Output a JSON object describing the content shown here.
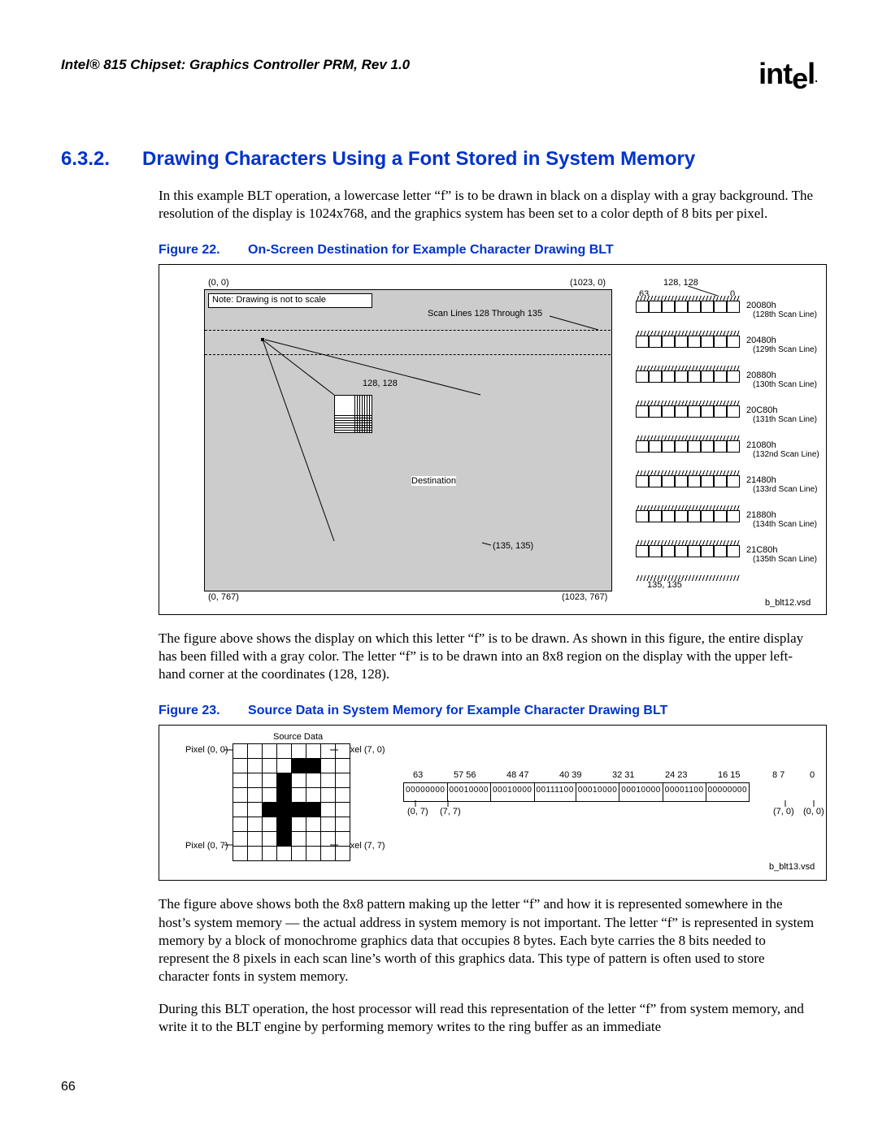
{
  "header": {
    "doc_title": "Intel® 815 Chipset: Graphics Controller PRM, Rev 1.0",
    "logo_text": "intel"
  },
  "section": {
    "number": "6.3.2.",
    "title": "Drawing Characters Using a Font Stored in System Memory"
  },
  "para1": "In this example BLT operation, a lowercase letter “f” is to be drawn in black on a display with a gray background. The resolution of the display is 1024x768, and the graphics system has been set to a color depth of 8 bits per pixel.",
  "fig22": {
    "caption_no": "Figure 22.",
    "caption_text": "On-Screen Destination for Example Character Drawing BLT",
    "labels": {
      "tl": "(0, 0)",
      "tr": "(1023, 0)",
      "bl": "(0, 767)",
      "br": "(1023, 767)",
      "note": "Note: Drawing is not to scale",
      "scan": "Scan Lines 128 Through 135",
      "c128": "128, 128",
      "dest": "Destination",
      "c135": "(135, 135)",
      "top63": "63",
      "top0": "0",
      "top128": "128, 128",
      "bot135": "135, 135",
      "row0a": "20080h",
      "row0b": "(128th Scan Line)",
      "row1a": "20480h",
      "row1b": "(129th Scan Line)",
      "row2a": "20880h",
      "row2b": "(130th Scan Line)",
      "row3a": "20C80h",
      "row3b": "(131th Scan Line)",
      "row4a": "21080h",
      "row4b": "(132nd Scan Line)",
      "row5a": "21480h",
      "row5b": "(133rd Scan Line)",
      "row6a": "21880h",
      "row6b": "(134th Scan Line)",
      "row7a": "21C80h",
      "row7b": "(135th Scan Line)",
      "vsd": "b_blt12.vsd"
    }
  },
  "para2": "The figure above shows the display on which this letter “f” is to be drawn. As shown in this figure, the entire display has been filled with a gray color. The letter “f” is to be drawn into an 8x8 region on the display with the upper left-hand corner at the coordinates (128, 128).",
  "fig23": {
    "caption_no": "Figure 23.",
    "caption_text": "Source Data in System Memory for Example Character Drawing BLT",
    "labels": {
      "srcdata": "Source Data",
      "p00": "Pixel (0, 0)",
      "p70": "Pixel (7, 0)",
      "p07": "Pixel (0, 7)",
      "p77": "Pixel (7, 7)",
      "b63": "63",
      "b57": "57 56",
      "b48": "48 47",
      "b40": "40 39",
      "b32": "32 31",
      "b24": "24 23",
      "b16": "16 15",
      "b8": "8 7",
      "b0": "0",
      "byte0": "00000000",
      "byte1": "00010000",
      "byte2": "00010000",
      "byte3": "00111100",
      "byte4": "00010000",
      "byte5": "00010000",
      "byte6": "00001100",
      "byte7": "00000000",
      "under07": "(0, 7)",
      "under77": "(7, 7)",
      "under70r": "(7, 0)",
      "under00r": "(0, 0)",
      "vsd": "b_blt13.vsd"
    }
  },
  "para3": "The figure above shows both the 8x8 pattern making up the letter “f” and how it is represented somewhere in the host’s system memory — the actual address in system memory is not important. The letter “f” is represented in system memory by a block of monochrome graphics data that occupies 8 bytes. Each byte carries the 8 bits needed to represent the 8 pixels in each scan line’s worth of this graphics data. This type of pattern is often used to store character fonts in system memory.",
  "para4": "During this BLT operation, the host processor will read this representation of the letter “f” from system memory, and write it to the BLT engine by performing memory writes to the ring buffer as an immediate",
  "page_number": "66"
}
